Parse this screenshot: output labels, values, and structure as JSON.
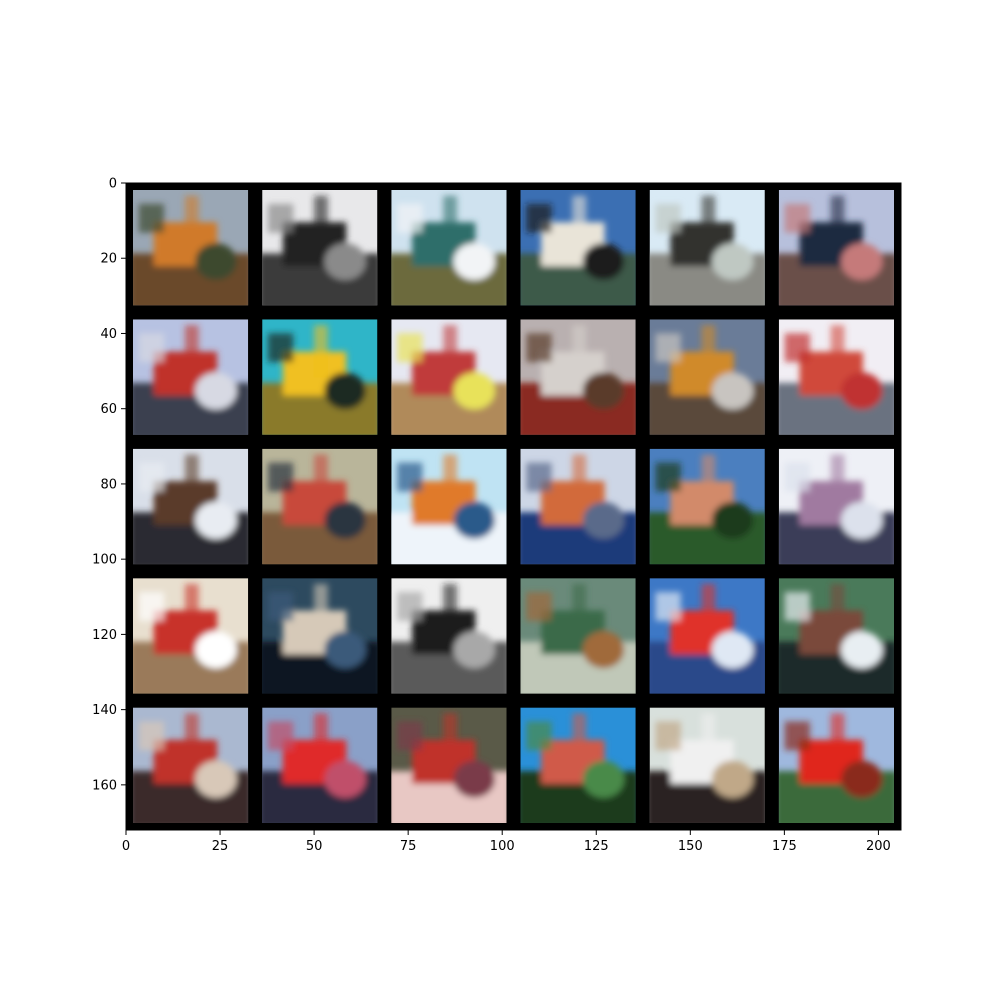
{
  "figure": {
    "x_ticks": [
      "0",
      "25",
      "50",
      "75",
      "100",
      "125",
      "150",
      "175",
      "200"
    ],
    "y_ticks": [
      "0",
      "20",
      "40",
      "60",
      "80",
      "100",
      "120",
      "140",
      "160"
    ],
    "grid": {
      "rows": 5,
      "cols": 6
    },
    "x_range": [
      0,
      206
    ],
    "y_range": [
      0,
      172
    ],
    "tiles": [
      {
        "sky": "#9aa7b5",
        "ground": "#6b4a2c",
        "accent": "#d07a2a",
        "shade": "#3d4a2f"
      },
      {
        "sky": "#e8e8ea",
        "ground": "#3a3a3a",
        "accent": "#222222",
        "shade": "#8a8a8a"
      },
      {
        "sky": "#cfe2ef",
        "ground": "#6c6a3e",
        "accent": "#2f6e6a",
        "shade": "#f2f4f6"
      },
      {
        "sky": "#3b6fb3",
        "ground": "#3d5a4a",
        "accent": "#e9e4d8",
        "shade": "#1c1c1c"
      },
      {
        "sky": "#d9eaf5",
        "ground": "#8a8a84",
        "accent": "#30302e",
        "shade": "#bfc8c2"
      },
      {
        "sky": "#b7c0dc",
        "ground": "#6a4f4a",
        "accent": "#1d2a3f",
        "shade": "#c57a7a"
      },
      {
        "sky": "#b7c2e2",
        "ground": "#3a4150",
        "accent": "#c0302a",
        "shade": "#d7d9e3"
      },
      {
        "sky": "#2fb5c8",
        "ground": "#8a7a2a",
        "accent": "#f0c020",
        "shade": "#1e2a22"
      },
      {
        "sky": "#e6e8f2",
        "ground": "#b08a5a",
        "accent": "#c03a3a",
        "shade": "#e8e25a"
      },
      {
        "sky": "#b9b0b0",
        "ground": "#8a2a20",
        "accent": "#d5d0cc",
        "shade": "#5a3a2a"
      },
      {
        "sky": "#6a7c98",
        "ground": "#5a4a3a",
        "accent": "#d08a2a",
        "shade": "#c8c4c0"
      },
      {
        "sky": "#f1eef4",
        "ground": "#6a7280",
        "accent": "#d04a3a",
        "shade": "#c03030"
      },
      {
        "sky": "#d9dfe9",
        "ground": "#2a2a30",
        "accent": "#5a3a2a",
        "shade": "#e8ecf2"
      },
      {
        "sky": "#b9b59a",
        "ground": "#7a5a3a",
        "accent": "#c84a3a",
        "shade": "#2a3440"
      },
      {
        "sky": "#bfe3f3",
        "ground": "#eef4fa",
        "accent": "#e07a2a",
        "shade": "#2a5a8a"
      },
      {
        "sky": "#cdd6e6",
        "ground": "#1a3a7a",
        "accent": "#d26a3a",
        "shade": "#5a6a8a"
      },
      {
        "sky": "#4b7fbf",
        "ground": "#2a5a2a",
        "accent": "#d28a6a",
        "shade": "#1a3a1a"
      },
      {
        "sky": "#eef0f6",
        "ground": "#3a3e58",
        "accent": "#a07aa0",
        "shade": "#dce1ec"
      },
      {
        "sky": "#e8dfcf",
        "ground": "#9a7a5a",
        "accent": "#c8302a",
        "shade": "#ffffff"
      },
      {
        "sky": "#2d4a5f",
        "ground": "#0e1420",
        "accent": "#d6c9b8",
        "shade": "#3a5a7a"
      },
      {
        "sky": "#efefef",
        "ground": "#5a5a5a",
        "accent": "#1e1e1e",
        "shade": "#a8a8a8"
      },
      {
        "sky": "#6a8a7a",
        "ground": "#c0c8b8",
        "accent": "#3a6a4a",
        "shade": "#a06a3a"
      },
      {
        "sky": "#3d78c6",
        "ground": "#2a4a8a",
        "accent": "#e0302a",
        "shade": "#dfe8f4"
      },
      {
        "sky": "#4a7a5a",
        "ground": "#1a2a2a",
        "accent": "#7a4a3a",
        "shade": "#e8eef2"
      },
      {
        "sky": "#aab8d0",
        "ground": "#3a2a2a",
        "accent": "#c0302a",
        "shade": "#d8c8b8"
      },
      {
        "sky": "#8aa0c8",
        "ground": "#2a2a40",
        "accent": "#e02a2a",
        "shade": "#c0506a"
      },
      {
        "sky": "#5a5a48",
        "ground": "#e8c8c4",
        "accent": "#c0302a",
        "shade": "#7a3a4a"
      },
      {
        "sky": "#2a90d8",
        "ground": "#1a3a1a",
        "accent": "#d05a4a",
        "shade": "#4a8a4a"
      },
      {
        "sky": "#d8e0dc",
        "ground": "#2a2420",
        "accent": "#f0f0f0",
        "shade": "#c0a888"
      },
      {
        "sky": "#9fb8de",
        "ground": "#3a6a3a",
        "accent": "#e0281a",
        "shade": "#8a2a1a"
      }
    ]
  }
}
